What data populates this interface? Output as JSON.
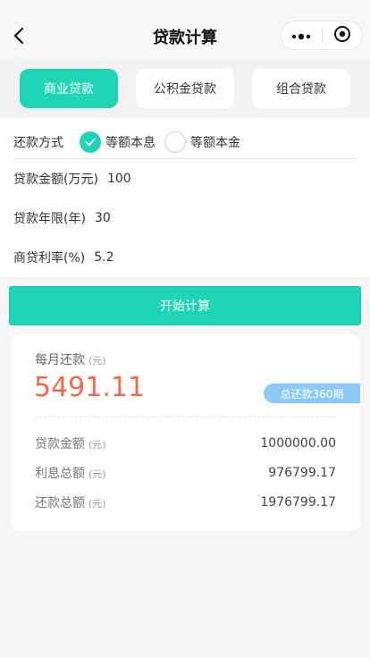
{
  "header": {
    "title": "贷款计算",
    "back_icon": "chevron-left-icon",
    "menu_icon": "more-dots-icon",
    "target_icon": "target-circle-icon"
  },
  "tabs": [
    {
      "label": "商业贷款",
      "active": true
    },
    {
      "label": "公积金贷款",
      "active": false
    },
    {
      "label": "组合贷款",
      "active": false
    }
  ],
  "form": {
    "repay_method_label": "还款方式",
    "options": [
      {
        "label": "等额本息",
        "checked": true
      },
      {
        "label": "等额本金",
        "checked": false
      }
    ],
    "amount_label": "贷款金额(万元)",
    "amount_value": "100",
    "years_label": "贷款年限(年)",
    "years_value": "30",
    "rate_label": "商贷利率(%)",
    "rate_value": "5.2"
  },
  "calc_button": "开始计算",
  "result": {
    "monthly_label": "每月还款",
    "monthly_unit": "(元)",
    "monthly_value": "5491.11",
    "total_period": "总还款360期",
    "rows": [
      {
        "label": "贷款金额",
        "unit": "(元)",
        "value": "1000000.00"
      },
      {
        "label": "利息总额",
        "unit": "(元)",
        "value": "976799.17"
      },
      {
        "label": "还款总额",
        "unit": "(元)",
        "value": "1976799.17"
      }
    ]
  },
  "colors": {
    "accent": "#20d5b5",
    "monthly_value": "#ef6b4c",
    "badge": "#8dc9f3"
  }
}
